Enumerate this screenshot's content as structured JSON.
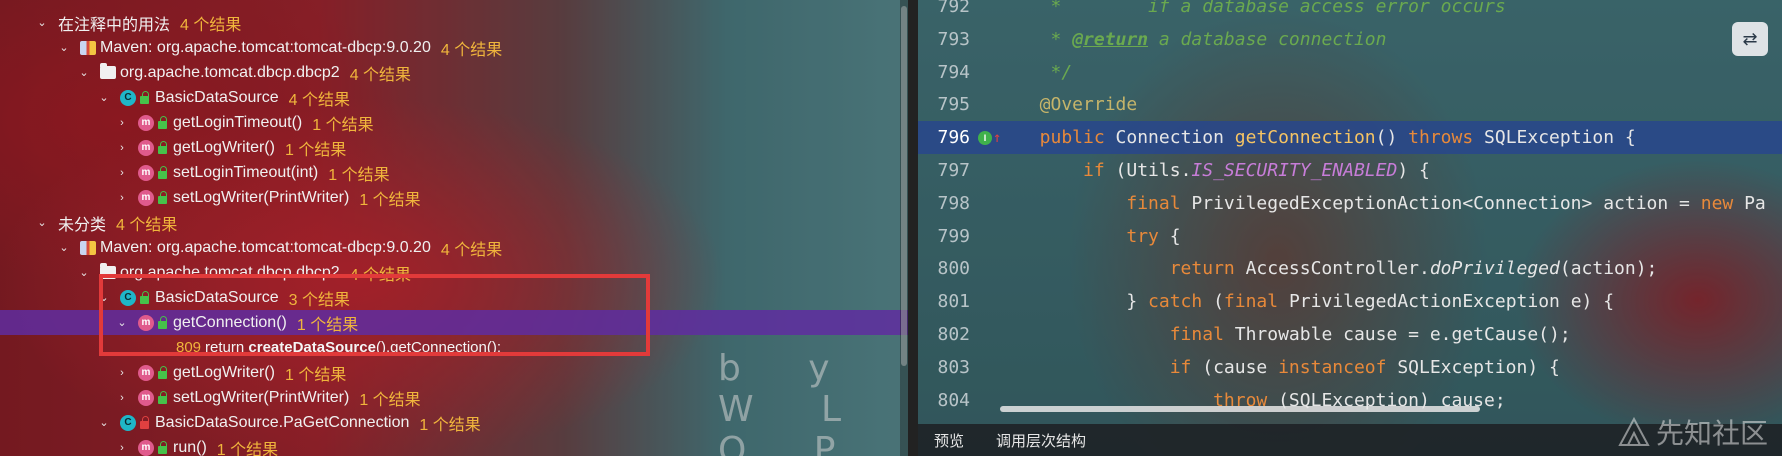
{
  "left_panel": {
    "rows": [
      {
        "type": "group",
        "label": "在注释中的用法",
        "count": "4 个结果"
      },
      {
        "type": "maven",
        "label": "Maven: org.apache.tomcat:tomcat-dbcp:9.0.20",
        "count": "4 个结果"
      },
      {
        "type": "package",
        "label": "org.apache.tomcat.dbcp.dbcp2",
        "count": "4 个结果"
      },
      {
        "type": "class",
        "label": "BasicDataSource",
        "count": "4 个结果"
      },
      {
        "type": "method",
        "label": "getLoginTimeout()",
        "count": "1 个结果"
      },
      {
        "type": "method",
        "label": "getLogWriter()",
        "count": "1 个结果"
      },
      {
        "type": "method",
        "label": "setLoginTimeout(int)",
        "count": "1 个结果"
      },
      {
        "type": "method",
        "label": "setLogWriter(PrintWriter)",
        "count": "1 个结果"
      },
      {
        "type": "group",
        "label": "未分类",
        "count": "4 个结果"
      },
      {
        "type": "maven",
        "label": "Maven: org.apache.tomcat:tomcat-dbcp:9.0.20",
        "count": "4 个结果"
      },
      {
        "type": "package",
        "label": "org.apache.tomcat.dbcp.dbcp2",
        "count": "4 个结果"
      },
      {
        "type": "class",
        "label": "BasicDataSource",
        "count": "3 个结果"
      },
      {
        "type": "method",
        "label": "getConnection()",
        "count": "1 个结果",
        "selected": true
      },
      {
        "type": "snippet",
        "line": "809",
        "before": "return ",
        "bold": "createDataSource",
        "after": "().getConnection();"
      },
      {
        "type": "method",
        "label": "getLogWriter()",
        "count": "1 个结果"
      },
      {
        "type": "method",
        "label": "setLogWriter(PrintWriter)",
        "count": "1 个结果"
      },
      {
        "type": "class",
        "label": "BasicDataSource.PaGetConnection",
        "count": "1 个结果"
      },
      {
        "type": "method",
        "label": "run()",
        "count": "1 个结果"
      }
    ],
    "watermark": "b y W L O P"
  },
  "editor": {
    "lines": [
      {
        "num": "792",
        "parts": [
          [
            "cm",
            "   *        if a database access error occurs"
          ]
        ]
      },
      {
        "num": "793",
        "parts": [
          [
            "cm",
            "   * "
          ],
          [
            "cm-tag",
            "@return"
          ],
          [
            "cm",
            " a database connection"
          ]
        ]
      },
      {
        "num": "794",
        "parts": [
          [
            "cm",
            "   */"
          ]
        ]
      },
      {
        "num": "795",
        "parts": [
          [
            "ann",
            "  @Override"
          ]
        ]
      },
      {
        "num": "796",
        "current": true,
        "parts": [
          [
            "k",
            "  public "
          ],
          [
            "code",
            "Connection "
          ],
          [
            "fn",
            "getConnection"
          ],
          [
            "code",
            "() "
          ],
          [
            "k",
            "throws "
          ],
          [
            "code",
            "SQLException {"
          ]
        ]
      },
      {
        "num": "797",
        "parts": [
          [
            "k",
            "      if "
          ],
          [
            "code",
            "(Utils."
          ],
          [
            "st",
            "IS_SECURITY_ENABLED"
          ],
          [
            "code",
            ") {"
          ]
        ]
      },
      {
        "num": "798",
        "parts": [
          [
            "k",
            "          final "
          ],
          [
            "code",
            "PrivilegedExceptionAction<Connection> action = "
          ],
          [
            "k",
            "new "
          ],
          [
            "code",
            "Pa"
          ]
        ]
      },
      {
        "num": "799",
        "parts": [
          [
            "k",
            "          try "
          ],
          [
            "code",
            "{"
          ]
        ]
      },
      {
        "num": "800",
        "parts": [
          [
            "k",
            "              return "
          ],
          [
            "code",
            "AccessController."
          ],
          [
            "sm",
            "doPrivileged"
          ],
          [
            "code",
            "(action);"
          ]
        ]
      },
      {
        "num": "801",
        "parts": [
          [
            "code",
            "          } "
          ],
          [
            "k",
            "catch "
          ],
          [
            "code",
            "("
          ],
          [
            "k",
            "final "
          ],
          [
            "code",
            "PrivilegedActionException e) {"
          ]
        ]
      },
      {
        "num": "802",
        "parts": [
          [
            "k",
            "              final "
          ],
          [
            "code",
            "Throwable cause = e.getCause();"
          ]
        ]
      },
      {
        "num": "803",
        "parts": [
          [
            "k",
            "              if "
          ],
          [
            "code",
            "(cause "
          ],
          [
            "k",
            "instanceof "
          ],
          [
            "code",
            "SQLException) {"
          ]
        ]
      },
      {
        "num": "804",
        "parts": [
          [
            "k",
            "                  throw "
          ],
          [
            "code",
            "(SQLException) cause;"
          ]
        ]
      }
    ],
    "tabs": [
      "预览",
      "调用层次结构"
    ],
    "watermark": "先知社区"
  },
  "colors": {
    "highlight_box": "#e23a3a",
    "selected_row": "#5f2da0",
    "current_line": "#284690"
  }
}
